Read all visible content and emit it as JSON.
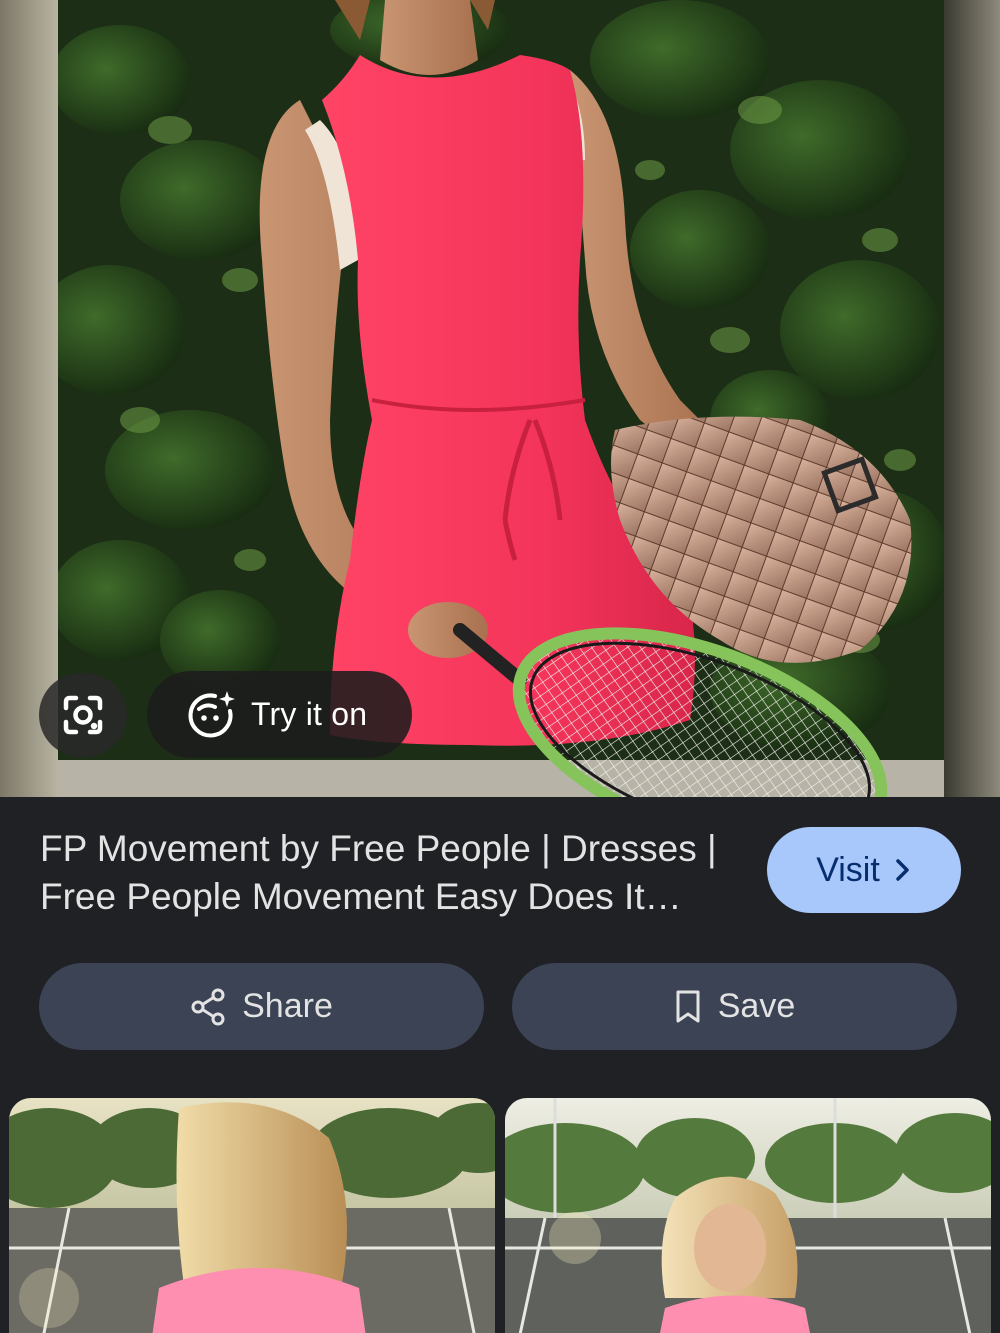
{
  "hero": {
    "try_it_on_label": "Try it on"
  },
  "result": {
    "title": "FP Movement by Free People | Dresses | Free People Movement Easy Does It…",
    "visit_label": "Visit"
  },
  "actions": {
    "share_label": "Share",
    "save_label": "Save"
  },
  "icons": {
    "lens": "google-lens-icon",
    "try_on": "sparkle-face-icon",
    "visit": "chevron-right-icon",
    "share": "share-icon",
    "save": "bookmark-icon"
  },
  "colors": {
    "panel_bg": "#1f2125",
    "visit_bg": "#a8c7fa",
    "visit_text": "#062e6f",
    "action_bg": "#3b4354",
    "dress": "#f4345a"
  }
}
